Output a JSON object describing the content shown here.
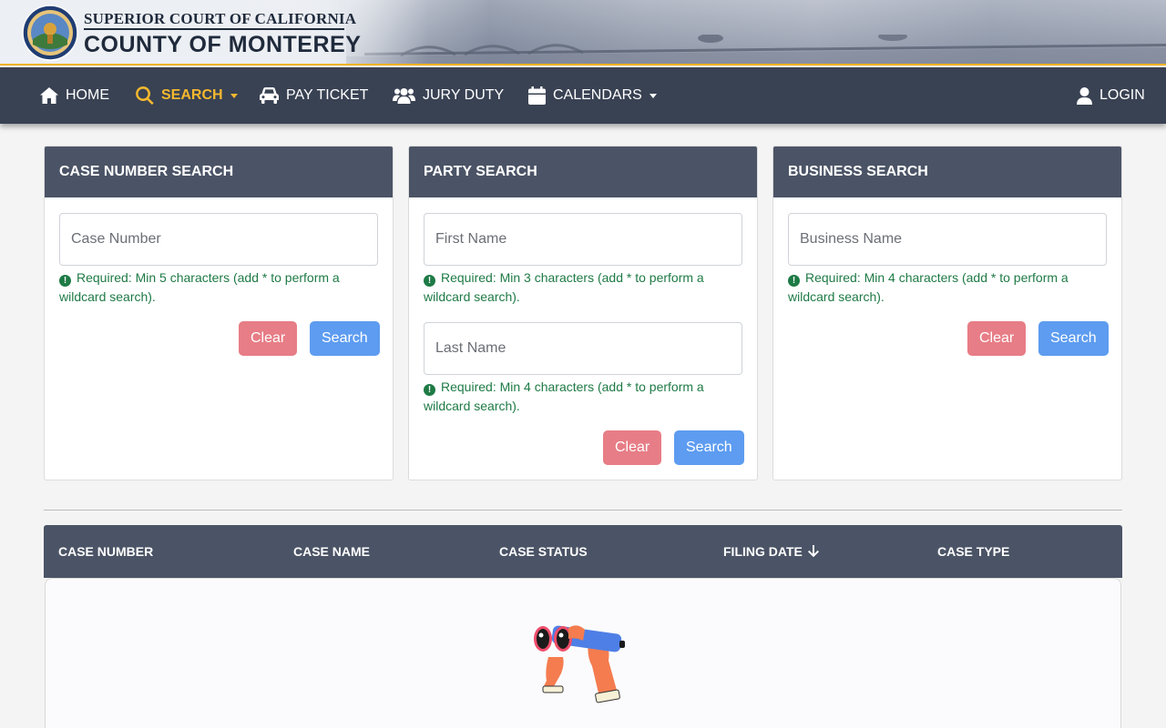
{
  "banner": {
    "title_line1": "SUPERIOR COURT OF CALIFORNIA",
    "title_line2": "COUNTY OF MONTEREY",
    "seal_icon": "court-seal-icon",
    "accent_color": "#f1b521"
  },
  "nav": {
    "items": [
      {
        "label": "HOME",
        "icon": "home-icon"
      },
      {
        "label": "SEARCH",
        "icon": "search-icon",
        "active": true,
        "dropdown": true
      },
      {
        "label": "PAY TICKET",
        "icon": "car-icon"
      },
      {
        "label": "JURY DUTY",
        "icon": "users-icon"
      },
      {
        "label": "CALENDARS",
        "icon": "calendar-icon",
        "dropdown": true
      }
    ],
    "login_label": "LOGIN",
    "active_color": "#f5b82e"
  },
  "cards": [
    {
      "title": "CASE NUMBER SEARCH",
      "fields": [
        {
          "placeholder": "Case Number",
          "value": "",
          "hint": "Required: Min 5 characters (add * to perform a wildcard search)."
        }
      ],
      "clear_label": "Clear",
      "search_label": "Search"
    },
    {
      "title": "PARTY SEARCH",
      "fields": [
        {
          "placeholder": "First Name",
          "value": "",
          "hint": "Required: Min 3 characters (add * to perform a wildcard search)."
        },
        {
          "placeholder": "Last Name",
          "value": "",
          "hint": "Required: Min 4 characters (add * to perform a wildcard search)."
        }
      ],
      "clear_label": "Clear",
      "search_label": "Search"
    },
    {
      "title": "BUSINESS SEARCH",
      "fields": [
        {
          "placeholder": "Business Name",
          "value": "",
          "hint": "Required: Min 4 characters (add * to perform a wildcard search)."
        }
      ],
      "clear_label": "Clear",
      "search_label": "Search"
    }
  ],
  "results": {
    "columns": [
      {
        "label": "CASE NUMBER"
      },
      {
        "label": "CASE NAME"
      },
      {
        "label": "CASE STATUS"
      },
      {
        "label": "FILING DATE",
        "sort": "arrow-down-icon"
      },
      {
        "label": "CASE TYPE"
      }
    ],
    "empty_illustration": "binoculars-hands-illustration"
  },
  "colors": {
    "nav_bg": "#394253",
    "card_header_bg": "#4b5466",
    "clear_button": "#e77d86",
    "search_button": "#5d9cf0",
    "hint_text": "#1e7a45"
  }
}
